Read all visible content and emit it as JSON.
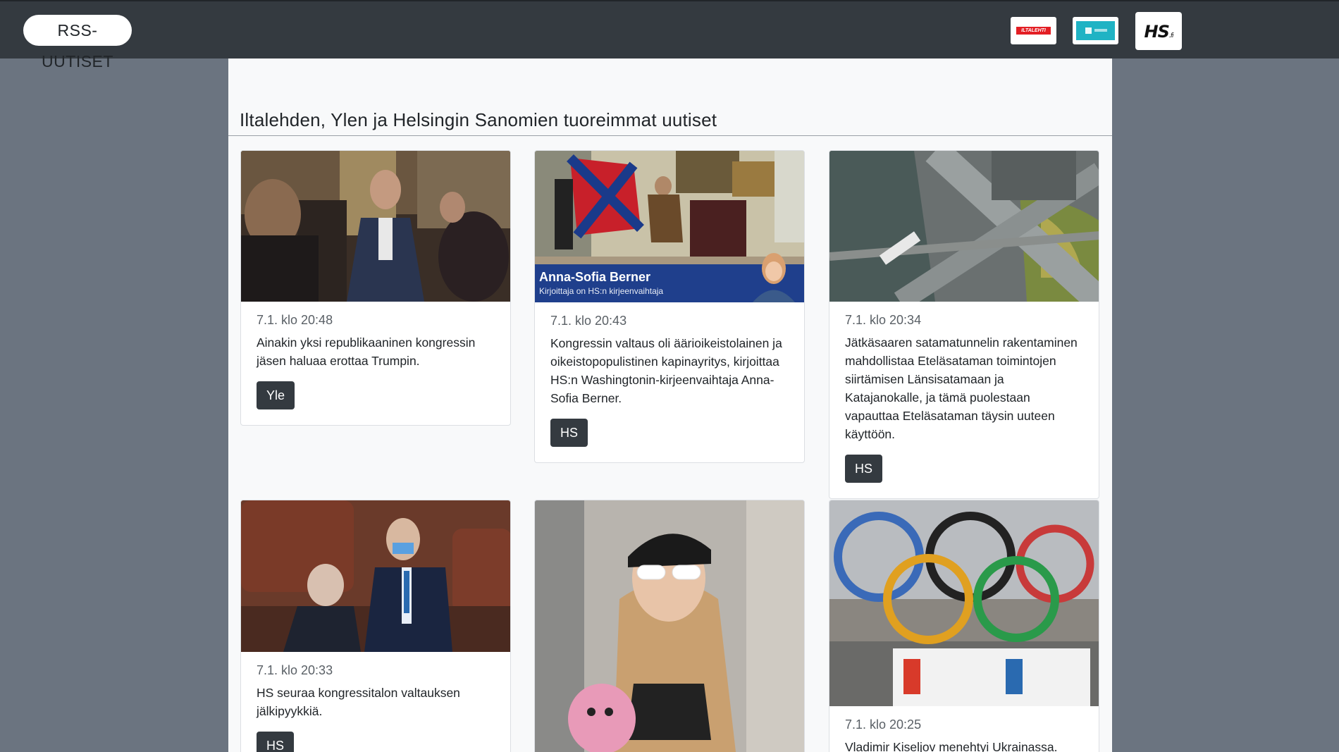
{
  "header": {
    "brand": "RSS-UUTISET",
    "logos": [
      {
        "name": "iltalehti",
        "label": "ILTALEHTI"
      },
      {
        "name": "yle-news",
        "label": "YLE NEWS"
      },
      {
        "name": "hs-fi",
        "label": "HS",
        "suffix": ".fi"
      }
    ]
  },
  "main": {
    "title": "Iltalehden, Ylen ja Helsingin Sanomien tuoreimmat uutiset",
    "articles": [
      {
        "date": "7.1. klo 20:48",
        "text": "Ainakin yksi republikaaninen kongressin jäsen haluaa erottaa Trumpin.",
        "source": "Yle",
        "image": "capitol-hallway-photo"
      },
      {
        "date": "7.1. klo 20:43",
        "text": "Kongressin valtaus oli äärioikeistolainen ja oikeistopopulistinen kapinayritys, kirjoittaa HS:n Washingtonin-kirjeenvaihtaja Anna-Sofia Berner.",
        "source": "HS",
        "image": "capitol-flag-photo",
        "banner_name": "Anna-Sofia Berner",
        "banner_sub": "Kirjoittaja on HS:n kirjeenvaihtaja"
      },
      {
        "date": "7.1. klo 20:34",
        "text": "Jätkäsaaren satamatunnelin rakentaminen mahdollistaa Eteläsataman toimintojen siirtämisen Länsisatamaan ja Katajanokalle, ja tämä puolestaan vapauttaa Eteläsataman täysin uuteen käyttöön.",
        "source": "HS",
        "image": "harbor-aerial-photo"
      },
      {
        "date": "7.1. klo 20:33",
        "text": "HS seuraa kongressitalon valtauksen jälkipyykkiä.",
        "source": "HS",
        "image": "senate-chamber-photo"
      },
      {
        "date": "",
        "text": "",
        "source": "",
        "image": "celebrity-photo"
      },
      {
        "date": "7.1. klo 20:25",
        "text": "Vladimir Kiseljov menehtyi Ukrainassa.",
        "source": "",
        "image": "olympic-rings-photo"
      }
    ]
  },
  "colors": {
    "navbar": "#343a40",
    "page_bg": "#6b7480",
    "container_bg": "#f8f9fa",
    "button": "#343a40",
    "banner": "#1f3f8c"
  }
}
